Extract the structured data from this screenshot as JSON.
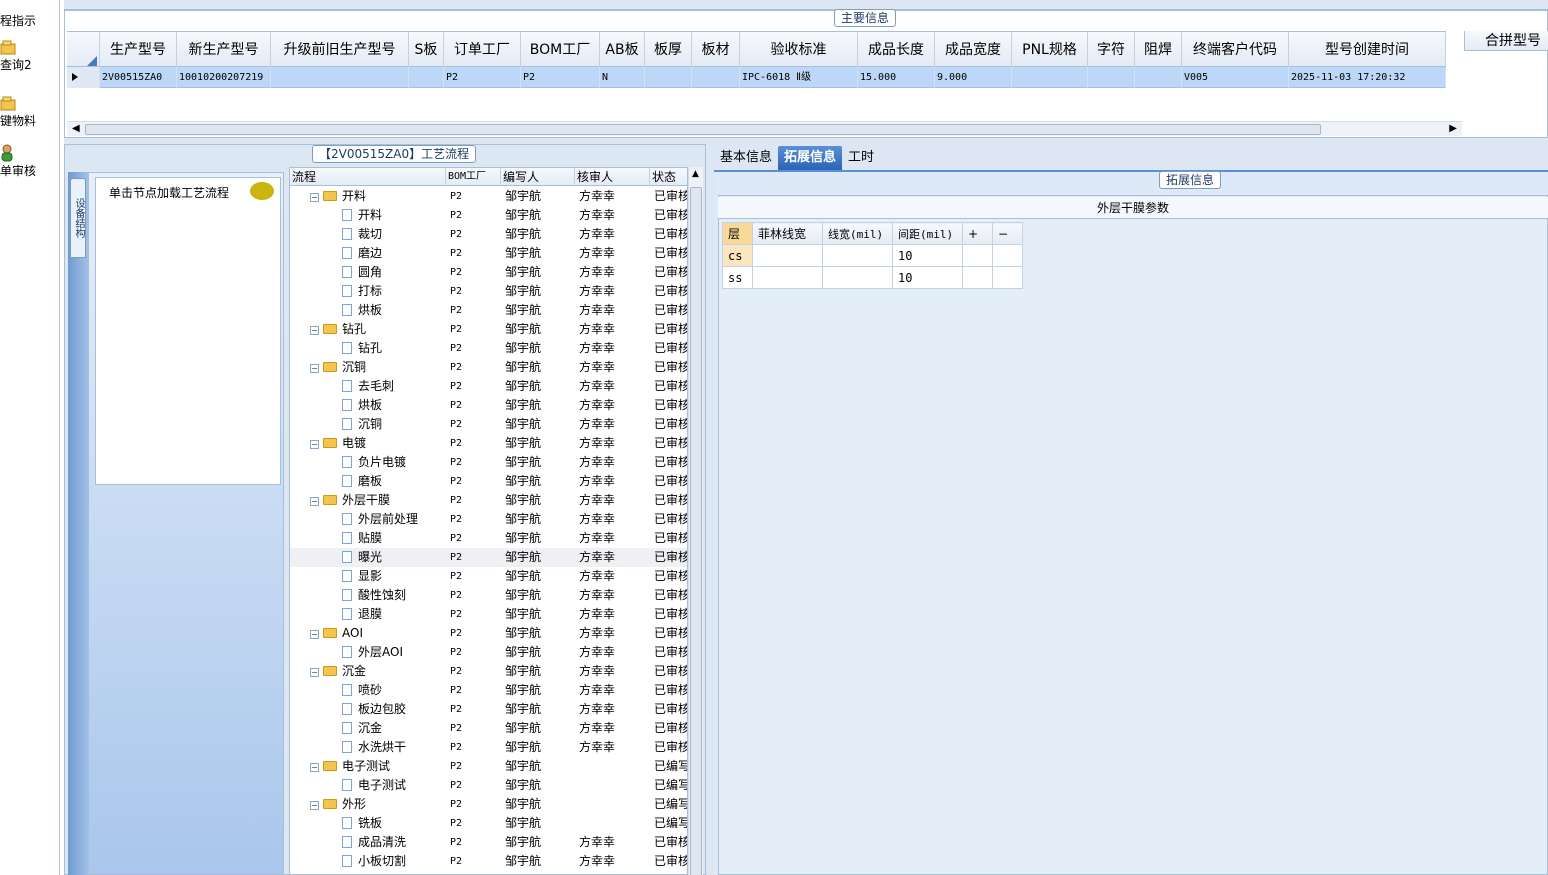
{
  "nav": {
    "items": [
      {
        "label": "程指示",
        "icon": "folder-icon"
      },
      {
        "label": "查询2",
        "icon": "folder-icon"
      },
      {
        "label": "键物料",
        "icon": "folder-icon"
      },
      {
        "label": "单审核",
        "icon": "user-icon"
      }
    ]
  },
  "main_info": {
    "caption": "主要信息",
    "columns": [
      "生产型号",
      "新生产型号",
      "升级前旧生产型号",
      "S板",
      "订单工厂",
      "BOM工厂",
      "AB板",
      "板厚",
      "板材",
      "验收标准",
      "成品长度",
      "成品宽度",
      "PNL规格",
      "字符",
      "阻焊",
      "终端客户代码",
      "型号创建时间"
    ],
    "row": [
      "2V00515ZA0",
      "10010200207219",
      "",
      "",
      "P2",
      "P2",
      "N",
      "",
      "",
      "IPC-6018 Ⅱ级",
      "15.000",
      "9.000",
      "",
      "",
      "",
      "V005",
      "2025-11-03 17:20:32"
    ],
    "extra_column": "合拼型号"
  },
  "process": {
    "caption": "【2V00515ZA0】工艺流程",
    "vtab_label": "设备结构",
    "note": "单击节点加载工艺流程",
    "columns": [
      "流程",
      "BOM工厂",
      "编写人",
      "核审人",
      "状态"
    ],
    "rows": [
      {
        "name": "开料",
        "level": 0,
        "factory": "P2",
        "writer": "邹宇航",
        "reviewer": "方幸幸",
        "status": "已审核"
      },
      {
        "name": "开料",
        "level": 1,
        "factory": "P2",
        "writer": "邹宇航",
        "reviewer": "方幸幸",
        "status": "已审核"
      },
      {
        "name": "裁切",
        "level": 1,
        "factory": "P2",
        "writer": "邹宇航",
        "reviewer": "方幸幸",
        "status": "已审核"
      },
      {
        "name": "磨边",
        "level": 1,
        "factory": "P2",
        "writer": "邹宇航",
        "reviewer": "方幸幸",
        "status": "已审核"
      },
      {
        "name": "圆角",
        "level": 1,
        "factory": "P2",
        "writer": "邹宇航",
        "reviewer": "方幸幸",
        "status": "已审核"
      },
      {
        "name": "打标",
        "level": 1,
        "factory": "P2",
        "writer": "邹宇航",
        "reviewer": "方幸幸",
        "status": "已审核"
      },
      {
        "name": "烘板",
        "level": 1,
        "factory": "P2",
        "writer": "邹宇航",
        "reviewer": "方幸幸",
        "status": "已审核"
      },
      {
        "name": "钻孔",
        "level": 0,
        "factory": "P2",
        "writer": "邹宇航",
        "reviewer": "方幸幸",
        "status": "已审核"
      },
      {
        "name": "钻孔",
        "level": 1,
        "factory": "P2",
        "writer": "邹宇航",
        "reviewer": "方幸幸",
        "status": "已审核"
      },
      {
        "name": "沉铜",
        "level": 0,
        "factory": "P2",
        "writer": "邹宇航",
        "reviewer": "方幸幸",
        "status": "已审核"
      },
      {
        "name": "去毛刺",
        "level": 1,
        "factory": "P2",
        "writer": "邹宇航",
        "reviewer": "方幸幸",
        "status": "已审核"
      },
      {
        "name": "烘板",
        "level": 1,
        "factory": "P2",
        "writer": "邹宇航",
        "reviewer": "方幸幸",
        "status": "已审核"
      },
      {
        "name": "沉铜",
        "level": 1,
        "factory": "P2",
        "writer": "邹宇航",
        "reviewer": "方幸幸",
        "status": "已审核"
      },
      {
        "name": "电镀",
        "level": 0,
        "factory": "P2",
        "writer": "邹宇航",
        "reviewer": "方幸幸",
        "status": "已审核"
      },
      {
        "name": "负片电镀",
        "level": 1,
        "factory": "P2",
        "writer": "邹宇航",
        "reviewer": "方幸幸",
        "status": "已审核"
      },
      {
        "name": "磨板",
        "level": 1,
        "factory": "P2",
        "writer": "邹宇航",
        "reviewer": "方幸幸",
        "status": "已审核"
      },
      {
        "name": "外层干膜",
        "level": 0,
        "factory": "P2",
        "writer": "邹宇航",
        "reviewer": "方幸幸",
        "status": "已审核"
      },
      {
        "name": "外层前处理",
        "level": 1,
        "factory": "P2",
        "writer": "邹宇航",
        "reviewer": "方幸幸",
        "status": "已审核"
      },
      {
        "name": "贴膜",
        "level": 1,
        "factory": "P2",
        "writer": "邹宇航",
        "reviewer": "方幸幸",
        "status": "已审核"
      },
      {
        "name": "曝光",
        "level": 1,
        "factory": "P2",
        "writer": "邹宇航",
        "reviewer": "方幸幸",
        "status": "已审核",
        "selected": true
      },
      {
        "name": "显影",
        "level": 1,
        "factory": "P2",
        "writer": "邹宇航",
        "reviewer": "方幸幸",
        "status": "已审核"
      },
      {
        "name": "酸性蚀刻",
        "level": 1,
        "factory": "P2",
        "writer": "邹宇航",
        "reviewer": "方幸幸",
        "status": "已审核"
      },
      {
        "name": "退膜",
        "level": 1,
        "factory": "P2",
        "writer": "邹宇航",
        "reviewer": "方幸幸",
        "status": "已审核"
      },
      {
        "name": "AOI",
        "level": 0,
        "factory": "P2",
        "writer": "邹宇航",
        "reviewer": "方幸幸",
        "status": "已审核"
      },
      {
        "name": "外层AOI",
        "level": 1,
        "factory": "P2",
        "writer": "邹宇航",
        "reviewer": "方幸幸",
        "status": "已审核"
      },
      {
        "name": "沉金",
        "level": 0,
        "factory": "P2",
        "writer": "邹宇航",
        "reviewer": "方幸幸",
        "status": "已审核"
      },
      {
        "name": "喷砂",
        "level": 1,
        "factory": "P2",
        "writer": "邹宇航",
        "reviewer": "方幸幸",
        "status": "已审核"
      },
      {
        "name": "板边包胶",
        "level": 1,
        "factory": "P2",
        "writer": "邹宇航",
        "reviewer": "方幸幸",
        "status": "已审核"
      },
      {
        "name": "沉金",
        "level": 1,
        "factory": "P2",
        "writer": "邹宇航",
        "reviewer": "方幸幸",
        "status": "已审核"
      },
      {
        "name": "水洗烘干",
        "level": 1,
        "factory": "P2",
        "writer": "邹宇航",
        "reviewer": "方幸幸",
        "status": "已审核"
      },
      {
        "name": "电子测试",
        "level": 0,
        "factory": "P2",
        "writer": "邹宇航",
        "reviewer": "",
        "status": "已编写"
      },
      {
        "name": "电子测试",
        "level": 1,
        "factory": "P2",
        "writer": "邹宇航",
        "reviewer": "",
        "status": "已编写"
      },
      {
        "name": "外形",
        "level": 0,
        "factory": "P2",
        "writer": "邹宇航",
        "reviewer": "",
        "status": "已编写"
      },
      {
        "name": "铣板",
        "level": 1,
        "factory": "P2",
        "writer": "邹宇航",
        "reviewer": "",
        "status": "已编写"
      },
      {
        "name": "成品清洗",
        "level": 1,
        "factory": "P2",
        "writer": "邹宇航",
        "reviewer": "方幸幸",
        "status": "已审核"
      },
      {
        "name": "小板切割",
        "level": 1,
        "factory": "P2",
        "writer": "邹宇航",
        "reviewer": "方幸幸",
        "status": "已审核"
      }
    ]
  },
  "right": {
    "tabs": [
      {
        "label": "基本信息",
        "active": false
      },
      {
        "label": "拓展信息",
        "active": true
      },
      {
        "label": "工时",
        "active": false
      }
    ],
    "group_caption": "拓展信息",
    "section_title": "外层干膜参数",
    "table": {
      "columns": [
        "层",
        "菲林线宽",
        "线宽(mil)",
        "间距(mil)",
        "+",
        "−"
      ],
      "rows": [
        [
          "cs",
          "",
          "",
          "10",
          "",
          ""
        ],
        [
          "ss",
          "",
          "",
          "10",
          "",
          ""
        ]
      ]
    }
  }
}
